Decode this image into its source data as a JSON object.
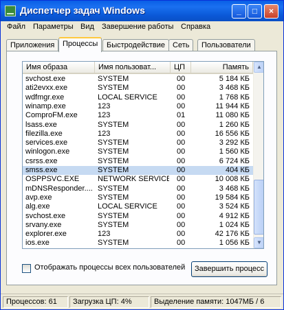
{
  "window": {
    "title": "Диспетчер задач Windows"
  },
  "menu": [
    "Файл",
    "Параметры",
    "Вид",
    "Завершение работы",
    "Справка"
  ],
  "tabs": [
    "Приложения",
    "Процессы",
    "Быстродействие",
    "Сеть",
    "Пользователи"
  ],
  "active_tab": "Процессы",
  "columns": [
    "Имя образа",
    "Имя пользоват...",
    "ЦП",
    "Память"
  ],
  "processes": [
    [
      "svchost.exe",
      "SYSTEM",
      "00",
      "5 184 КБ"
    ],
    [
      "ati2evxx.exe",
      "SYSTEM",
      "00",
      "3 468 КБ"
    ],
    [
      "wdfmgr.exe",
      "LOCAL SERVICE",
      "00",
      "1 768 КБ"
    ],
    [
      "winamp.exe",
      "123",
      "00",
      "11 944 КБ"
    ],
    [
      "ComproFM.exe",
      "123",
      "01",
      "11 080 КБ"
    ],
    [
      "lsass.exe",
      "SYSTEM",
      "00",
      "1 260 КБ"
    ],
    [
      "filezilla.exe",
      "123",
      "00",
      "16 556 КБ"
    ],
    [
      "services.exe",
      "SYSTEM",
      "00",
      "3 292 КБ"
    ],
    [
      "winlogon.exe",
      "SYSTEM",
      "00",
      "1 560 КБ"
    ],
    [
      "csrss.exe",
      "SYSTEM",
      "00",
      "6 724 КБ"
    ],
    [
      "smss.exe",
      "SYSTEM",
      "00",
      "404 КБ"
    ],
    [
      "OSPPSVC.EXE",
      "NETWORK SERVICE",
      "00",
      "10 008 КБ"
    ],
    [
      "mDNSResponder....",
      "SYSTEM",
      "00",
      "3 468 КБ"
    ],
    [
      "avp.exe",
      "SYSTEM",
      "00",
      "19 584 КБ"
    ],
    [
      "alg.exe",
      "LOCAL SERVICE",
      "00",
      "3 524 КБ"
    ],
    [
      "svchost.exe",
      "SYSTEM",
      "00",
      "4 912 КБ"
    ],
    [
      "srvany.exe",
      "SYSTEM",
      "00",
      "1 024 КБ"
    ],
    [
      "explorer.exe",
      "123",
      "00",
      "42 176 КБ"
    ],
    [
      "ios.exe",
      "SYSTEM",
      "00",
      "1 056 КБ"
    ]
  ],
  "selected_process": "smss.exe",
  "show_all_label": "Отображать процессы всех пользователей",
  "end_process_label": "Завершить процесс",
  "status": {
    "processes": "Процессов: 61",
    "cpu": "Загрузка ЦП: 4%",
    "memory": "Выделение памяти: 1047МБ / 6"
  },
  "colors": {
    "title_bar": "#0A5FE6",
    "selection": "#C6DAF2",
    "face": "#ECE9D8"
  }
}
